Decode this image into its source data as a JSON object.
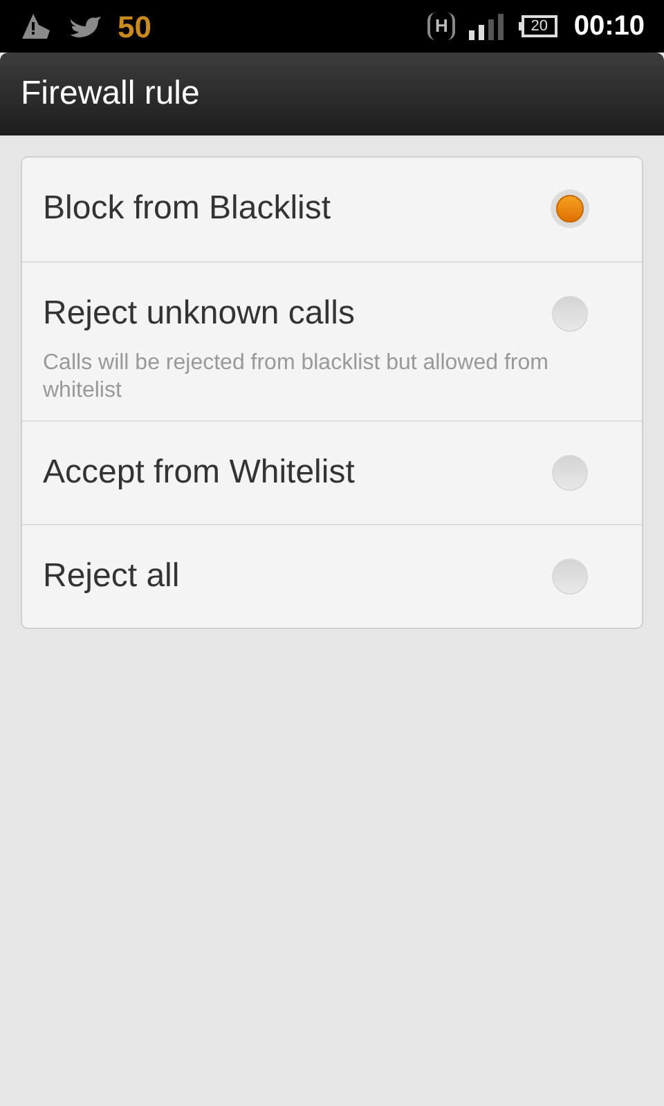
{
  "status_bar": {
    "count": "50",
    "network": "H",
    "battery": "20",
    "time": "00:10"
  },
  "title": "Firewall rule",
  "options": [
    {
      "label": "Block from Blacklist",
      "selected": true
    },
    {
      "label": "Reject unknown calls",
      "description": "Calls will be rejected from blacklist but allowed from whitelist",
      "selected": false
    },
    {
      "label": "Accept from Whitelist",
      "selected": false
    },
    {
      "label": "Reject all",
      "selected": false
    }
  ]
}
